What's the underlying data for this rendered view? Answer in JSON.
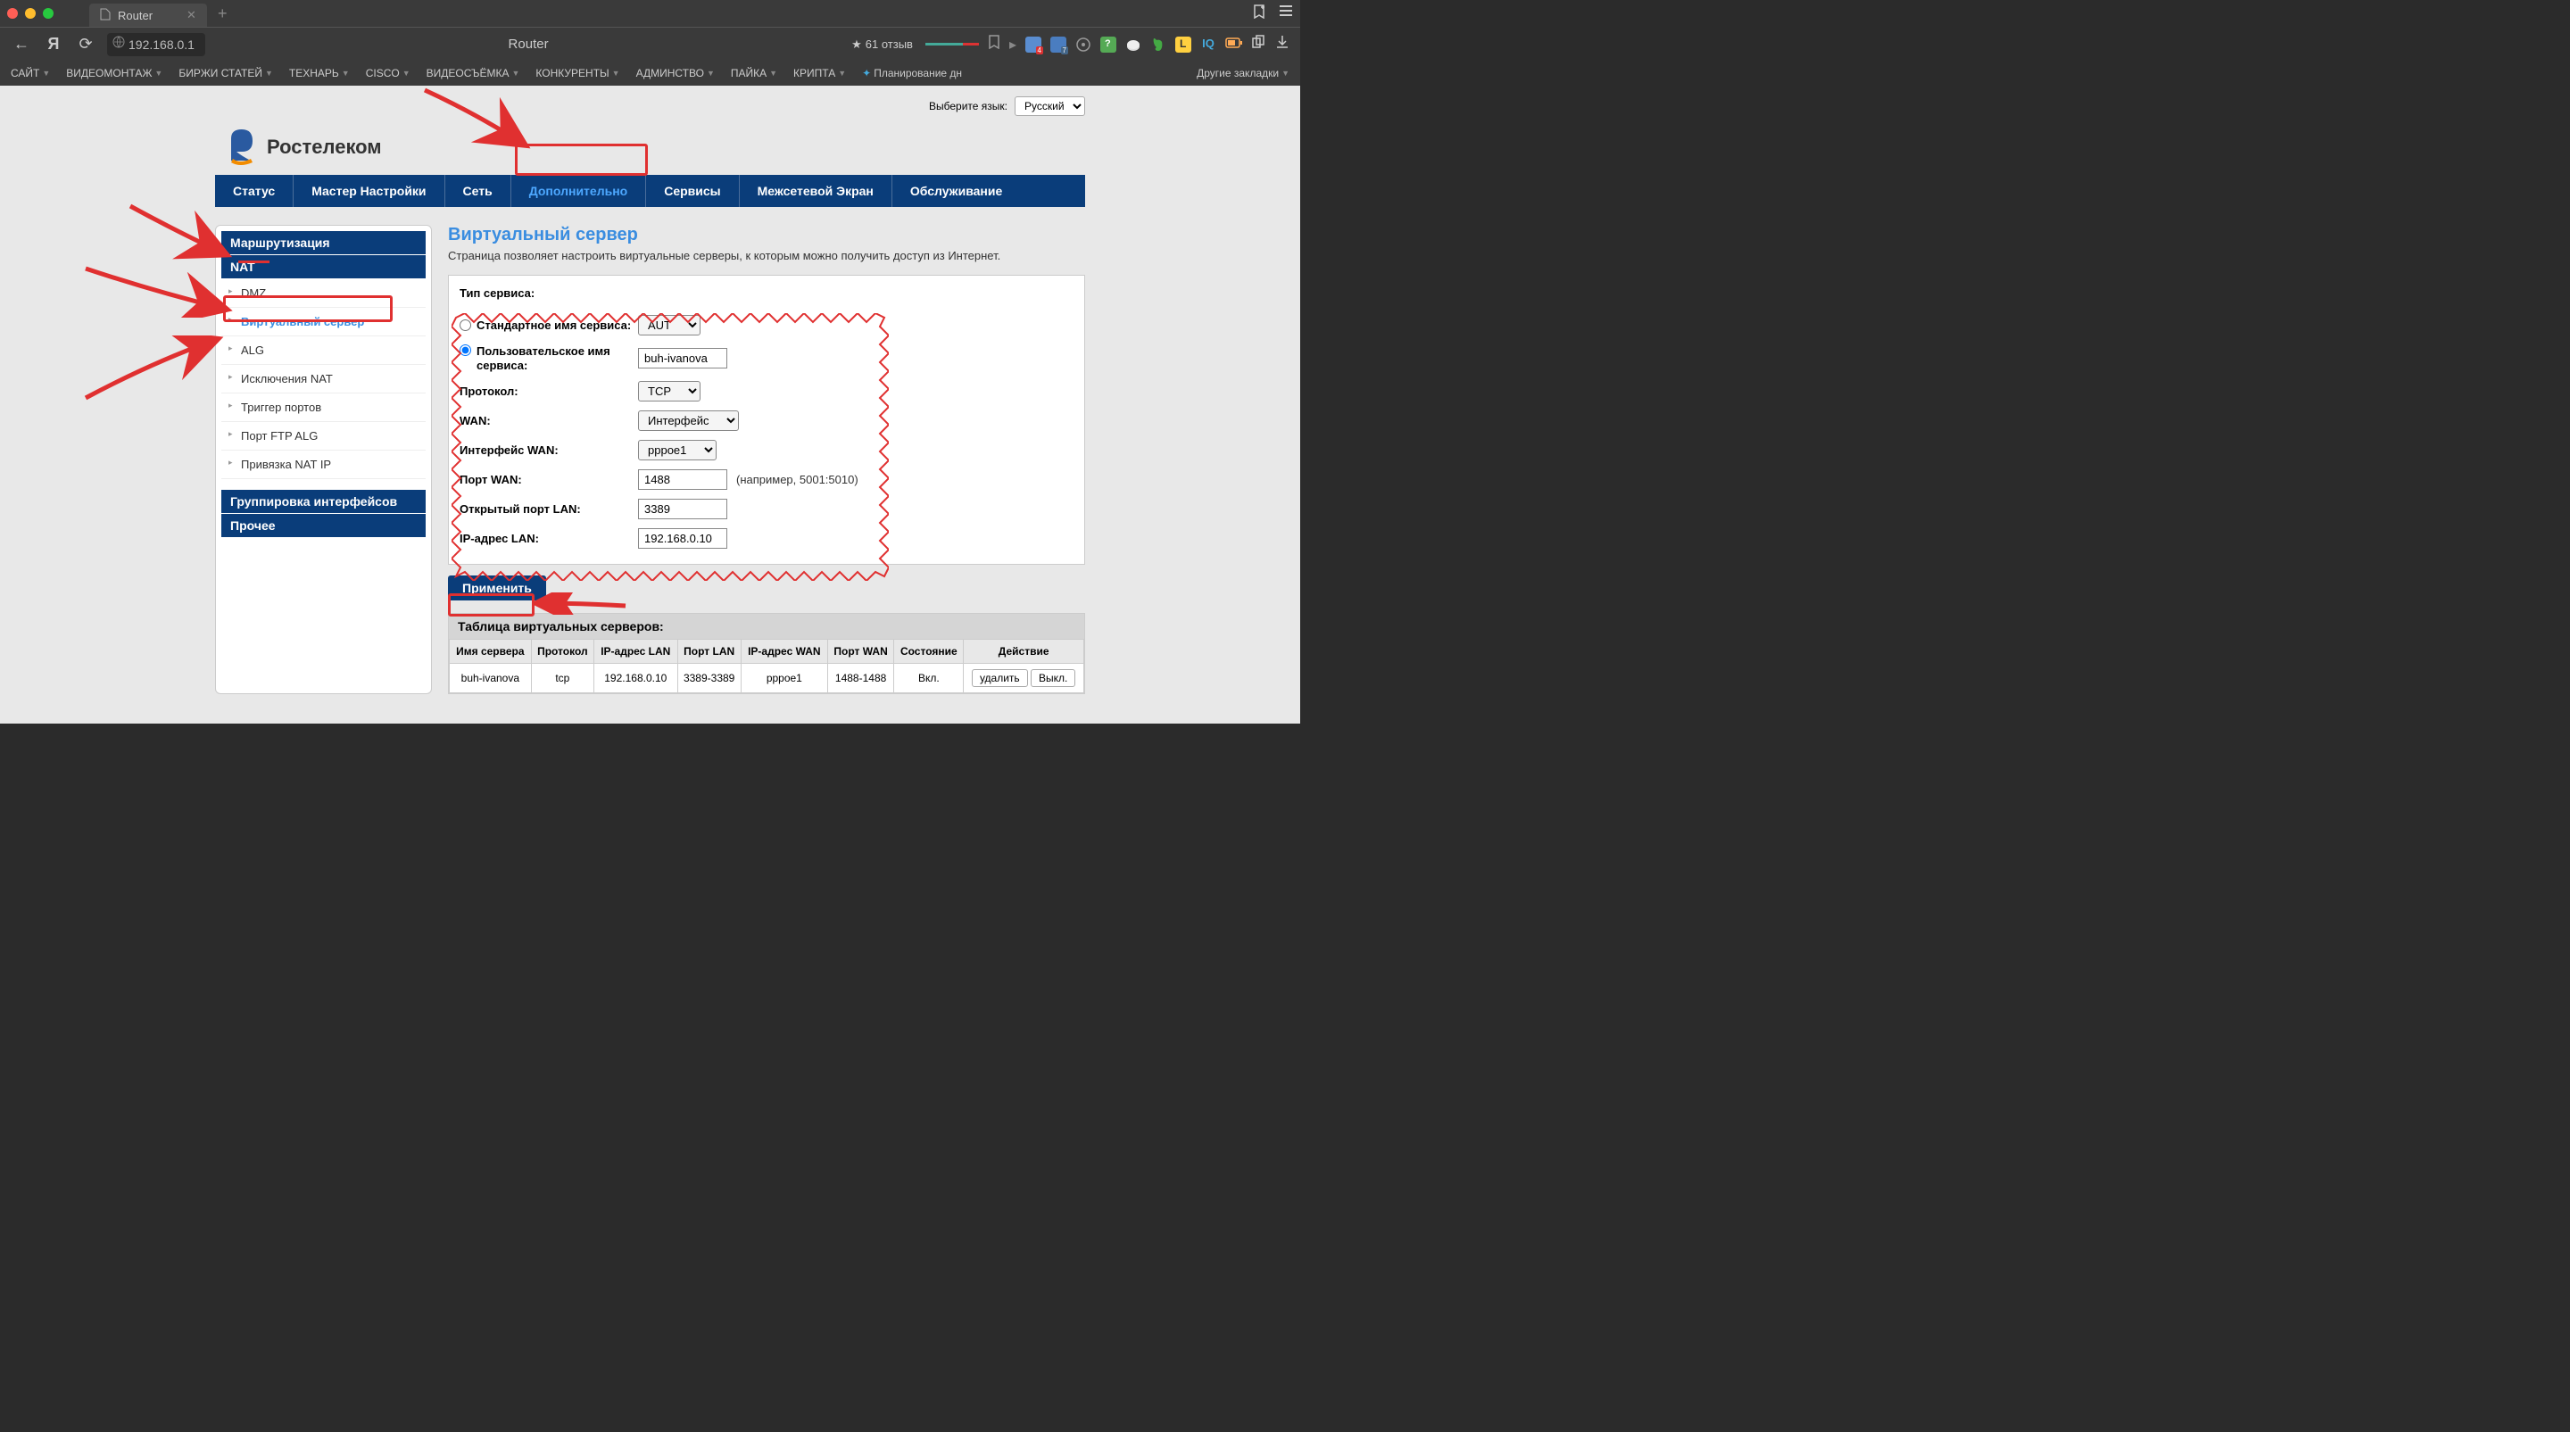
{
  "browser": {
    "tab_title": "Router",
    "url": "192.168.0.1",
    "page_title": "Router",
    "rating": "61 отзыв",
    "bookmarks": [
      "САЙТ",
      "ВИДЕОМОНТАЖ",
      "БИРЖИ СТАТЕЙ",
      "ТЕХНАРЬ",
      "CISCO",
      "ВИДЕОСЪЁМКА",
      "КОНКУРЕНТЫ",
      "АДМИНСТВО",
      "ПАЙКА",
      "КРИПТА"
    ],
    "bookmark_extra": "Планирование дн",
    "other_bookmarks": "Другие закладки"
  },
  "page": {
    "lang_label": "Выберите язык:",
    "lang_value": "Русский",
    "logo_text": "Ростелеком",
    "nav": [
      "Статус",
      "Мастер Настройки",
      "Сеть",
      "Дополнительно",
      "Сервисы",
      "Межсетевой Экран",
      "Обслуживание"
    ],
    "sidebar": {
      "section1": "Маршрутизация",
      "section2": "NAT",
      "items": [
        "DMZ",
        "Виртуальный сервер",
        "ALG",
        "Исключения NAT",
        "Триггер портов",
        "Порт FTP ALG",
        "Привязка NAT IP"
      ],
      "section3": "Группировка интерфейсов",
      "section4": "Прочее"
    },
    "panel": {
      "title": "Виртуальный сервер",
      "desc": "Страница позволяет настроить виртуальные серверы, к которым можно получить доступ из Интернет."
    },
    "form": {
      "service_type": "Тип сервиса:",
      "std_name": "Стандартное имя сервиса:",
      "std_value": "AUTH",
      "custom_name": "Пользовательское имя сервиса:",
      "custom_value": "buh-ivanova",
      "protocol": "Протокол:",
      "protocol_value": "TCP",
      "wan": "WAN:",
      "wan_value": "Интерфейс",
      "wan_iface": "Интерфейс WAN:",
      "wan_iface_value": "pppoe1",
      "wan_port": "Порт WAN:",
      "wan_port_value": "1488",
      "wan_port_hint": "(например, 5001:5010)",
      "lan_port": "Открытый порт LAN:",
      "lan_port_value": "3389",
      "lan_ip": "IP-адрес LAN:",
      "lan_ip_value": "192.168.0.10",
      "apply": "Применить"
    },
    "table": {
      "title": "Таблица виртуальных серверов:",
      "headers": [
        "Имя сервера",
        "Протокол",
        "IP-адрес LAN",
        "Порт LAN",
        "IP-адрес WAN",
        "Порт WAN",
        "Состояние",
        "Действие"
      ],
      "row": {
        "name": "buh-ivanova",
        "proto": "tcp",
        "lan_ip": "192.168.0.10",
        "lan_port": "3389-3389",
        "wan_ip": "pppoe1",
        "wan_port": "1488-1488",
        "state": "Вкл.",
        "del": "удалить",
        "off": "Выкл."
      }
    }
  }
}
